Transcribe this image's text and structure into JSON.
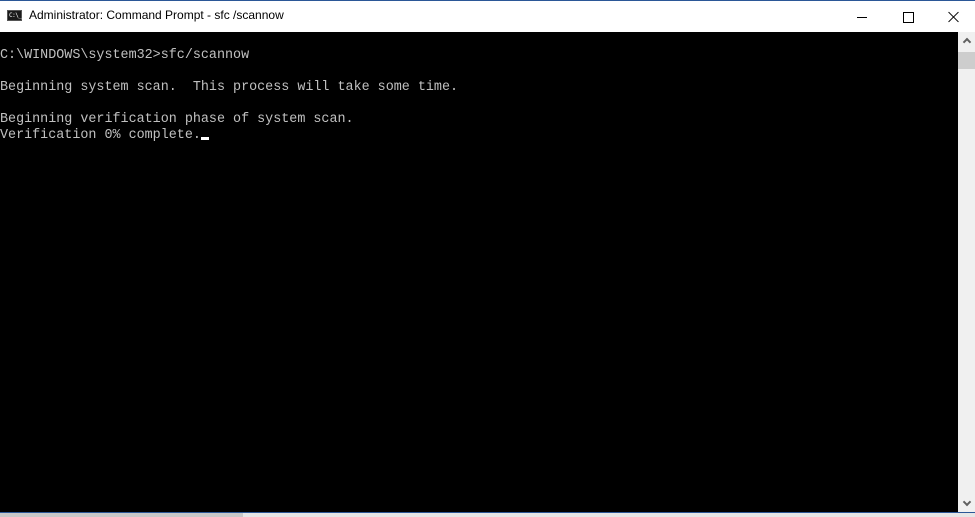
{
  "window": {
    "title": "Administrator: Command Prompt - sfc /scannow",
    "app_icon": "cmd-icon",
    "app_icon_glyph": "C:\\_",
    "controls": {
      "minimize": "minimize-icon",
      "maximize": "maximize-icon",
      "close": "close-icon"
    }
  },
  "console": {
    "lines": [
      "C:\\WINDOWS\\system32>sfc/scannow",
      "",
      "Beginning system scan.  This process will take some time.",
      "",
      "Beginning verification phase of system scan.",
      "Verification 0% complete."
    ],
    "progress_percent": 0,
    "colors": {
      "background": "#000000",
      "foreground": "#c0c0c0",
      "cursor": "#ffffff"
    }
  },
  "scrollbar": {
    "up_icon": "chevron-up-icon",
    "down_icon": "chevron-down-icon"
  },
  "accent_color": "#2b5797"
}
